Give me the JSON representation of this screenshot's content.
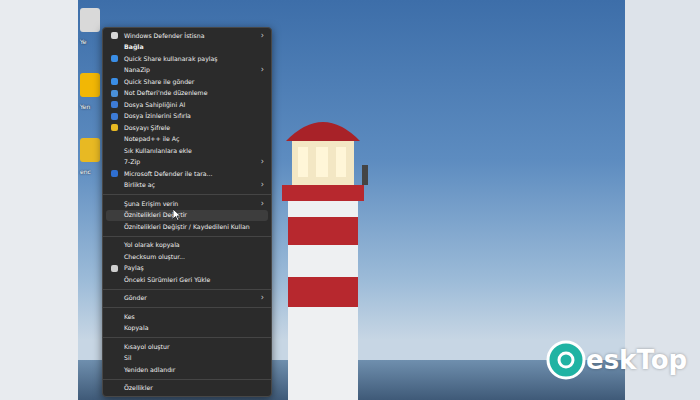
{
  "desktop": {
    "icons": [
      {
        "label": "Ye",
        "color": "#d9d9d9"
      },
      {
        "label": "Yen",
        "color": "#f2b705"
      },
      {
        "label": "enc",
        "color": "#e8b923"
      }
    ]
  },
  "menu": {
    "submenu_arrow": "›",
    "items": [
      {
        "kind": "item",
        "label": "Windows Defender İstisna",
        "submenu": true,
        "selected": false,
        "default": false,
        "color": "#d6d6d6"
      },
      {
        "kind": "item",
        "label": "Bağla",
        "submenu": false,
        "selected": false,
        "default": true
      },
      {
        "kind": "item",
        "label": "Quick Share kullanarak paylaş",
        "submenu": false,
        "selected": false,
        "default": false,
        "color": "#3a8ee6"
      },
      {
        "kind": "item",
        "label": "NanaZip",
        "submenu": true,
        "selected": false,
        "default": false
      },
      {
        "kind": "item",
        "label": "Quick Share ile gönder",
        "submenu": false,
        "selected": false,
        "default": false,
        "color": "#3a8ee6"
      },
      {
        "kind": "item",
        "label": "Not Defteri'nde düzenleme",
        "submenu": false,
        "selected": false,
        "default": false,
        "color": "#4a90d9"
      },
      {
        "kind": "item",
        "label": "Dosya Sahipliğini Al",
        "submenu": false,
        "selected": false,
        "default": false,
        "color": "#3d7bd6"
      },
      {
        "kind": "item",
        "label": "Dosya İzinlerini Sıfırla",
        "submenu": false,
        "selected": false,
        "default": false,
        "color": "#3d7bd6"
      },
      {
        "kind": "item",
        "label": "Dosyayı Şifrele",
        "submenu": false,
        "selected": false,
        "default": false,
        "color": "#e8b923"
      },
      {
        "kind": "item",
        "label": "Notepad++ ile Aç",
        "submenu": false,
        "selected": false,
        "default": false
      },
      {
        "kind": "item",
        "label": "Sık Kullanılanlara ekle",
        "submenu": false,
        "selected": false,
        "default": false
      },
      {
        "kind": "item",
        "label": "7-Zip",
        "submenu": true,
        "selected": false,
        "default": false
      },
      {
        "kind": "item",
        "label": "Microsoft Defender ile tara...",
        "submenu": false,
        "selected": false,
        "default": false,
        "color": "#2f6fd1"
      },
      {
        "kind": "item",
        "label": "Birlikte aç",
        "submenu": true,
        "selected": false,
        "default": false
      },
      {
        "kind": "separator"
      },
      {
        "kind": "item",
        "label": "Şuna Erişim verin",
        "submenu": true,
        "selected": false,
        "default": false
      },
      {
        "kind": "item",
        "label": "Öznitelikleri Değiştir",
        "submenu": false,
        "selected": true,
        "default": false
      },
      {
        "kind": "item",
        "label": "Öznitelikleri Değiştir / Kaydedileni Kullan",
        "submenu": false,
        "selected": false,
        "default": false
      },
      {
        "kind": "separator"
      },
      {
        "kind": "item",
        "label": "Yol olarak kopyala",
        "submenu": false,
        "selected": false,
        "default": false
      },
      {
        "kind": "item",
        "label": "Checksum oluştur...",
        "submenu": false,
        "selected": false,
        "default": false
      },
      {
        "kind": "item",
        "label": "Paylaş",
        "submenu": false,
        "selected": false,
        "default": false,
        "color": "#cfcfcf"
      },
      {
        "kind": "item",
        "label": "Önceki Sürümleri Geri Yükle",
        "submenu": false,
        "selected": false,
        "default": false
      },
      {
        "kind": "separator"
      },
      {
        "kind": "item",
        "label": "Gönder",
        "submenu": true,
        "selected": false,
        "default": false
      },
      {
        "kind": "separator"
      },
      {
        "kind": "item",
        "label": "Kes",
        "submenu": false,
        "selected": false,
        "default": false
      },
      {
        "kind": "item",
        "label": "Kopyala",
        "submenu": false,
        "selected": false,
        "default": false
      },
      {
        "kind": "separator"
      },
      {
        "kind": "item",
        "label": "Kısayol oluştur",
        "submenu": false,
        "selected": false,
        "default": false
      },
      {
        "kind": "item",
        "label": "Sil",
        "submenu": false,
        "selected": false,
        "default": false
      },
      {
        "kind": "item",
        "label": "Yeniden adlandır",
        "submenu": false,
        "selected": false,
        "default": false
      },
      {
        "kind": "separator"
      },
      {
        "kind": "item",
        "label": "Özellikler",
        "submenu": false,
        "selected": false,
        "default": false
      }
    ]
  },
  "watermark": {
    "text": "eskTop"
  }
}
